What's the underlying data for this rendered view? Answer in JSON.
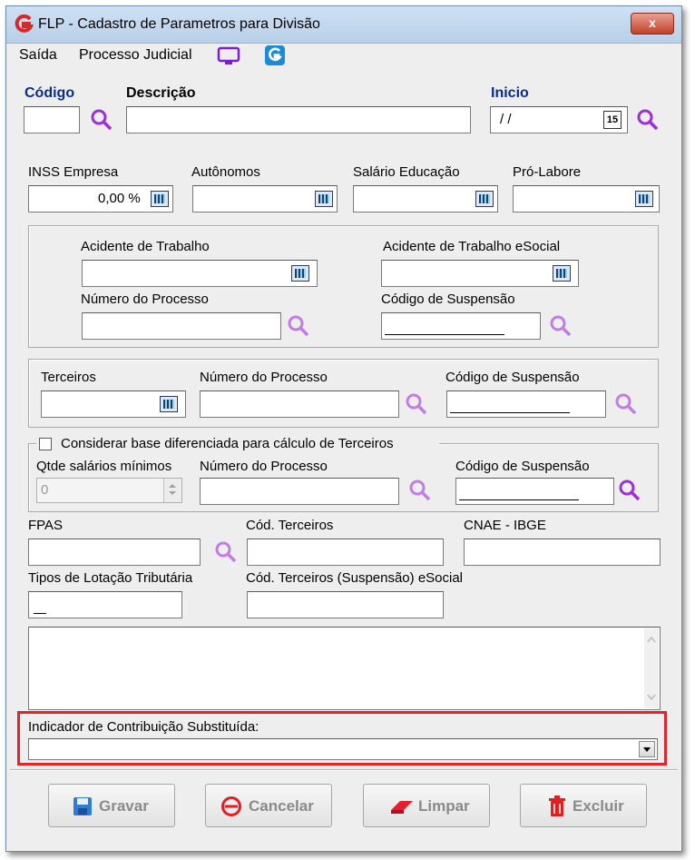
{
  "window": {
    "title": "FLP - Cadastro de Parametros para Divisão",
    "close_label": "x"
  },
  "menu": {
    "items": [
      {
        "label": "Saída"
      },
      {
        "label": "Processo Judicial"
      }
    ]
  },
  "header": {
    "codigo_label": "Código",
    "descricao_label": "Descrição",
    "inicio_label": "Inicio",
    "inicio_value": "/ /",
    "calendar_day": "15"
  },
  "rates": {
    "inss_empresa_label": "INSS Empresa",
    "inss_empresa_value": "0,00 %",
    "autonomos_label": "Autônomos",
    "salario_educacao_label": "Salário Educação",
    "pro_labore_label": "Pró-Labore"
  },
  "acidente": {
    "acidente_trabalho_label": "Acidente de Trabalho",
    "acidente_trabalho_esocial_label": "Acidente de Trabalho eSocial",
    "numero_processo_label": "Número do Processo",
    "codigo_suspensao_label": "Código de Suspensão"
  },
  "terceiros": {
    "terceiros_label": "Terceiros",
    "numero_processo_label": "Número do Processo",
    "codigo_suspensao_label": "Código de Suspensão"
  },
  "base_diferenciada": {
    "checkbox_label": "Considerar base diferenciada para cálculo de Terceiros",
    "qtde_salarios_label": "Qtde salários mínimos",
    "qtde_salarios_value": "0",
    "numero_processo_label": "Número do Processo",
    "codigo_suspensao_label": "Código de Suspensão"
  },
  "fpas": {
    "fpas_label": "FPAS",
    "cod_terceiros_label": "Cód. Terceiros",
    "cnae_label": "CNAE - IBGE",
    "tipos_lotacao_label": "Tipos de Lotação Tributária",
    "cod_terceiros_suspensao_label": "Cód. Terceiros (Suspensão) eSocial"
  },
  "indicador": {
    "label": "Indicador de Contribuição Substituída:"
  },
  "buttons": {
    "gravar": "Gravar",
    "cancelar": "Cancelar",
    "limpar": "Limpar",
    "excluir": "Excluir"
  },
  "colors": {
    "accent_label": "#0a2d8c",
    "highlight": "#e0242a",
    "search_icon": "#9b30d9"
  }
}
